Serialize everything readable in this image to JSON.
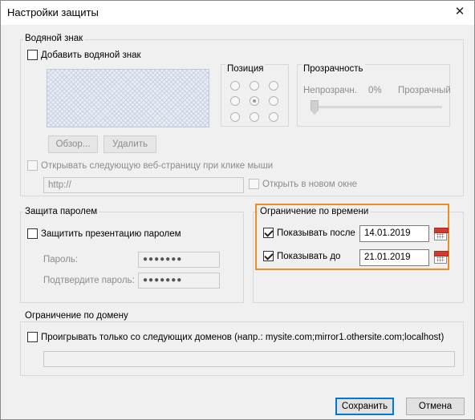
{
  "window": {
    "title": "Настройки защиты",
    "close_glyph": "✕"
  },
  "watermark": {
    "group_title": "Водяной знак",
    "add_checkbox_label": "Добавить водяной знак",
    "add_checked": false,
    "position_title": "Позиция",
    "position_selected": "center",
    "transparency_title": "Прозрачность",
    "transparency_left_label": "Непрозрачн.",
    "transparency_value": "0%",
    "transparency_right_label": "Прозрачный",
    "browse_button": "Обзор...",
    "delete_button": "Удалить",
    "open_url_checkbox_label": "Открывать следующую веб-страницу при клике мыши",
    "url_value": "http://",
    "new_window_checkbox_label": "Открыть в новом окне"
  },
  "password": {
    "group_title": "Защита паролем",
    "protect_checkbox_label": "Защитить презентацию паролем",
    "password_label": "Пароль:",
    "password_value": "●●●●●●●",
    "confirm_label": "Подтвердите пароль:",
    "confirm_value": "●●●●●●●"
  },
  "time_limit": {
    "group_title": "Ограничение по времени",
    "show_after_label": "Показывать после",
    "show_after_checked": true,
    "show_after_date": "14.01.2019",
    "show_until_label": "Показывать до",
    "show_until_checked": true,
    "show_until_date": "21.01.2019",
    "highlight_color": "#f08a24"
  },
  "domain": {
    "group_title": "Ограничение по домену",
    "checkbox_label": "Проигрывать только со следующих доменов (напр.: mysite.com;mirror1.othersite.com;localhost)",
    "domains_value": ""
  },
  "footer": {
    "save_button": "Сохранить",
    "cancel_button": "Отмена",
    "accent_color": "#0078d7"
  }
}
